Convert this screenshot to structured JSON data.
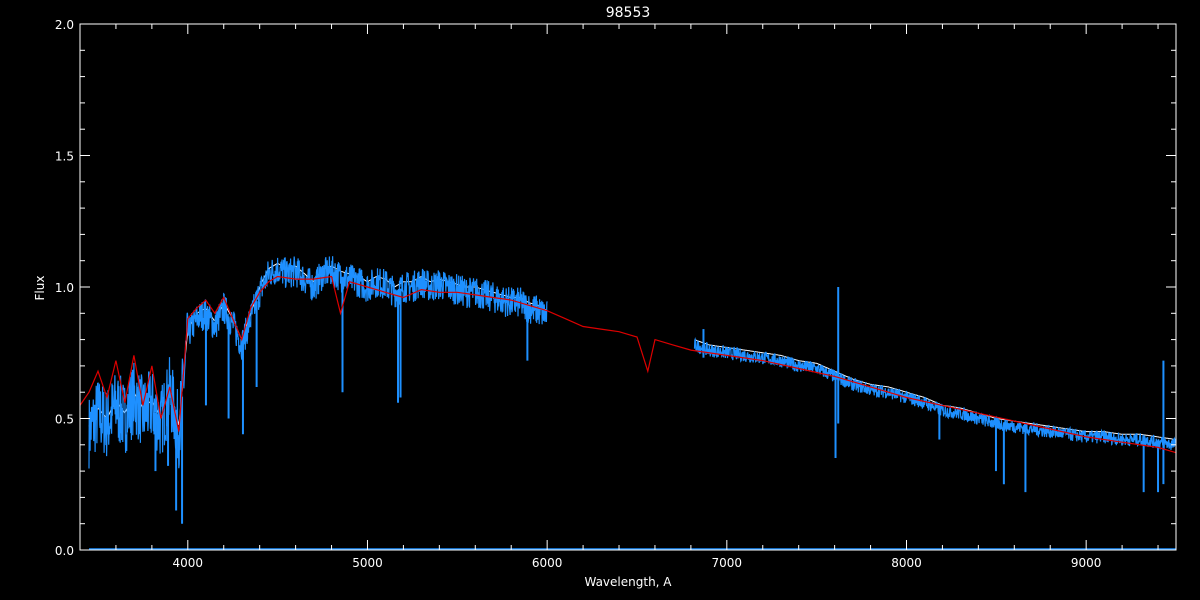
{
  "chart_data": {
    "type": "line",
    "title": "98553",
    "xlabel": "Wavelength, A",
    "ylabel": "Flux",
    "xlim": [
      3400,
      9500
    ],
    "ylim": [
      0.0,
      2.0
    ],
    "x_ticks": [
      4000,
      5000,
      6000,
      7000,
      8000,
      9000
    ],
    "x_tick_labels": [
      "4000",
      "5000",
      "6000",
      "7000",
      "8000",
      "9000"
    ],
    "y_ticks": [
      0.0,
      0.5,
      1.0,
      1.5,
      2.0
    ],
    "y_tick_labels": [
      "0.0",
      "0.5",
      "1.0",
      "1.5",
      "2.0"
    ],
    "grid": false,
    "legend": "none",
    "colors": {
      "background": "#000000",
      "axes": "#ffffff",
      "observed": "#1e90ff",
      "observed_white": "#ffffff",
      "model": "#dd0000",
      "error": "#1e90ff"
    },
    "series": [
      {
        "key": "observed_blue",
        "segments": [
          {
            "x": [
              3450,
              3500,
              3550,
              3600,
              3650,
              3700,
              3750,
              3800,
              3850,
              3900,
              3950,
              4000,
              4050,
              4100,
              4150,
              4200,
              4250,
              4300,
              4350,
              4400,
              4450,
              4500,
              4550,
              4600,
              4650,
              4700,
              4750,
              4800,
              4850,
              4900,
              4950,
              5000,
              5050,
              5100,
              5150,
              5200,
              5250,
              5300,
              5350,
              5400,
              5450,
              5500,
              5550,
              5600,
              5650,
              5700,
              5750,
              5800,
              5850,
              5900,
              5950,
              6000
            ],
            "y": [
              0.45,
              0.52,
              0.48,
              0.55,
              0.5,
              0.58,
              0.52,
              0.55,
              0.48,
              0.6,
              0.45,
              0.82,
              0.88,
              0.9,
              0.85,
              0.92,
              0.86,
              0.78,
              0.88,
              0.98,
              1.05,
              1.07,
              1.05,
              1.06,
              1.03,
              1.0,
              1.05,
              1.06,
              1.04,
              1.03,
              1.02,
              1.0,
              1.02,
              1.01,
              0.98,
              1.0,
              1.0,
              1.02,
              1.0,
              1.01,
              1.0,
              0.99,
              0.98,
              0.98,
              0.97,
              0.96,
              0.95,
              0.94,
              0.94,
              0.92,
              0.91,
              0.89
            ]
          },
          {
            "x": [
              6820,
              6900,
              7000,
              7100,
              7200,
              7300,
              7400,
              7500,
              7600,
              7700,
              7800,
              7900,
              8000,
              8100,
              8200,
              8300,
              8400,
              8500,
              8600,
              8700,
              8800,
              8900,
              9000,
              9100,
              9200,
              9300,
              9400,
              9500
            ],
            "y": [
              0.78,
              0.76,
              0.75,
              0.74,
              0.73,
              0.72,
              0.7,
              0.69,
              0.66,
              0.63,
              0.61,
              0.6,
              0.58,
              0.56,
              0.53,
              0.52,
              0.5,
              0.48,
              0.47,
              0.46,
              0.45,
              0.44,
              0.43,
              0.43,
              0.42,
              0.42,
              0.41,
              0.4
            ]
          }
        ],
        "absorption_lines": [
          {
            "x": 3820,
            "y": 0.3
          },
          {
            "x": 3890,
            "y": 0.32
          },
          {
            "x": 3935,
            "y": 0.15
          },
          {
            "x": 3968,
            "y": 0.1
          },
          {
            "x": 4101,
            "y": 0.55
          },
          {
            "x": 4227,
            "y": 0.5
          },
          {
            "x": 4307,
            "y": 0.44
          },
          {
            "x": 4383,
            "y": 0.62
          },
          {
            "x": 4861,
            "y": 0.6
          },
          {
            "x": 5170,
            "y": 0.56
          },
          {
            "x": 5184,
            "y": 0.58
          },
          {
            "x": 5890,
            "y": 0.72
          },
          {
            "x": 7605,
            "y": 0.35
          },
          {
            "x": 8183,
            "y": 0.42
          },
          {
            "x": 8498,
            "y": 0.3
          },
          {
            "x": 8542,
            "y": 0.25
          },
          {
            "x": 8662,
            "y": 0.22
          },
          {
            "x": 9320,
            "y": 0.22
          },
          {
            "x": 9400,
            "y": 0.22
          }
        ],
        "emission_spikes": [
          {
            "x": 7620,
            "y": 1.0
          },
          {
            "x": 9430,
            "y": 0.72
          },
          {
            "x": 6870,
            "y": 0.84
          }
        ]
      },
      {
        "key": "model_red",
        "x": [
          3400,
          3450,
          3500,
          3550,
          3600,
          3650,
          3700,
          3750,
          3800,
          3850,
          3900,
          3950,
          4000,
          4050,
          4100,
          4150,
          4200,
          4250,
          4300,
          4350,
          4400,
          4450,
          4500,
          4600,
          4700,
          4800,
          4850,
          4900,
          5000,
          5100,
          5200,
          5300,
          5400,
          5500,
          5600,
          5700,
          5800,
          5900,
          6000,
          6100,
          6200,
          6300,
          6400,
          6500,
          6560,
          6600,
          6700,
          6800,
          7000,
          7200,
          7400,
          7600,
          7800,
          8000,
          8200,
          8400,
          8600,
          8800,
          9000,
          9200,
          9400,
          9500
        ],
        "y": [
          0.55,
          0.6,
          0.68,
          0.58,
          0.72,
          0.56,
          0.74,
          0.55,
          0.7,
          0.5,
          0.62,
          0.45,
          0.88,
          0.92,
          0.95,
          0.9,
          0.96,
          0.88,
          0.8,
          0.92,
          0.98,
          1.02,
          1.04,
          1.03,
          1.03,
          1.04,
          0.9,
          1.02,
          1.0,
          0.98,
          0.96,
          0.99,
          0.98,
          0.98,
          0.97,
          0.96,
          0.95,
          0.93,
          0.91,
          0.88,
          0.85,
          0.84,
          0.83,
          0.81,
          0.68,
          0.8,
          0.78,
          0.76,
          0.74,
          0.72,
          0.69,
          0.66,
          0.62,
          0.58,
          0.55,
          0.52,
          0.49,
          0.46,
          0.43,
          0.41,
          0.39,
          0.37
        ]
      },
      {
        "key": "error_floor",
        "x": [
          3450,
          9500
        ],
        "y": [
          0.0,
          0.0
        ]
      }
    ]
  }
}
